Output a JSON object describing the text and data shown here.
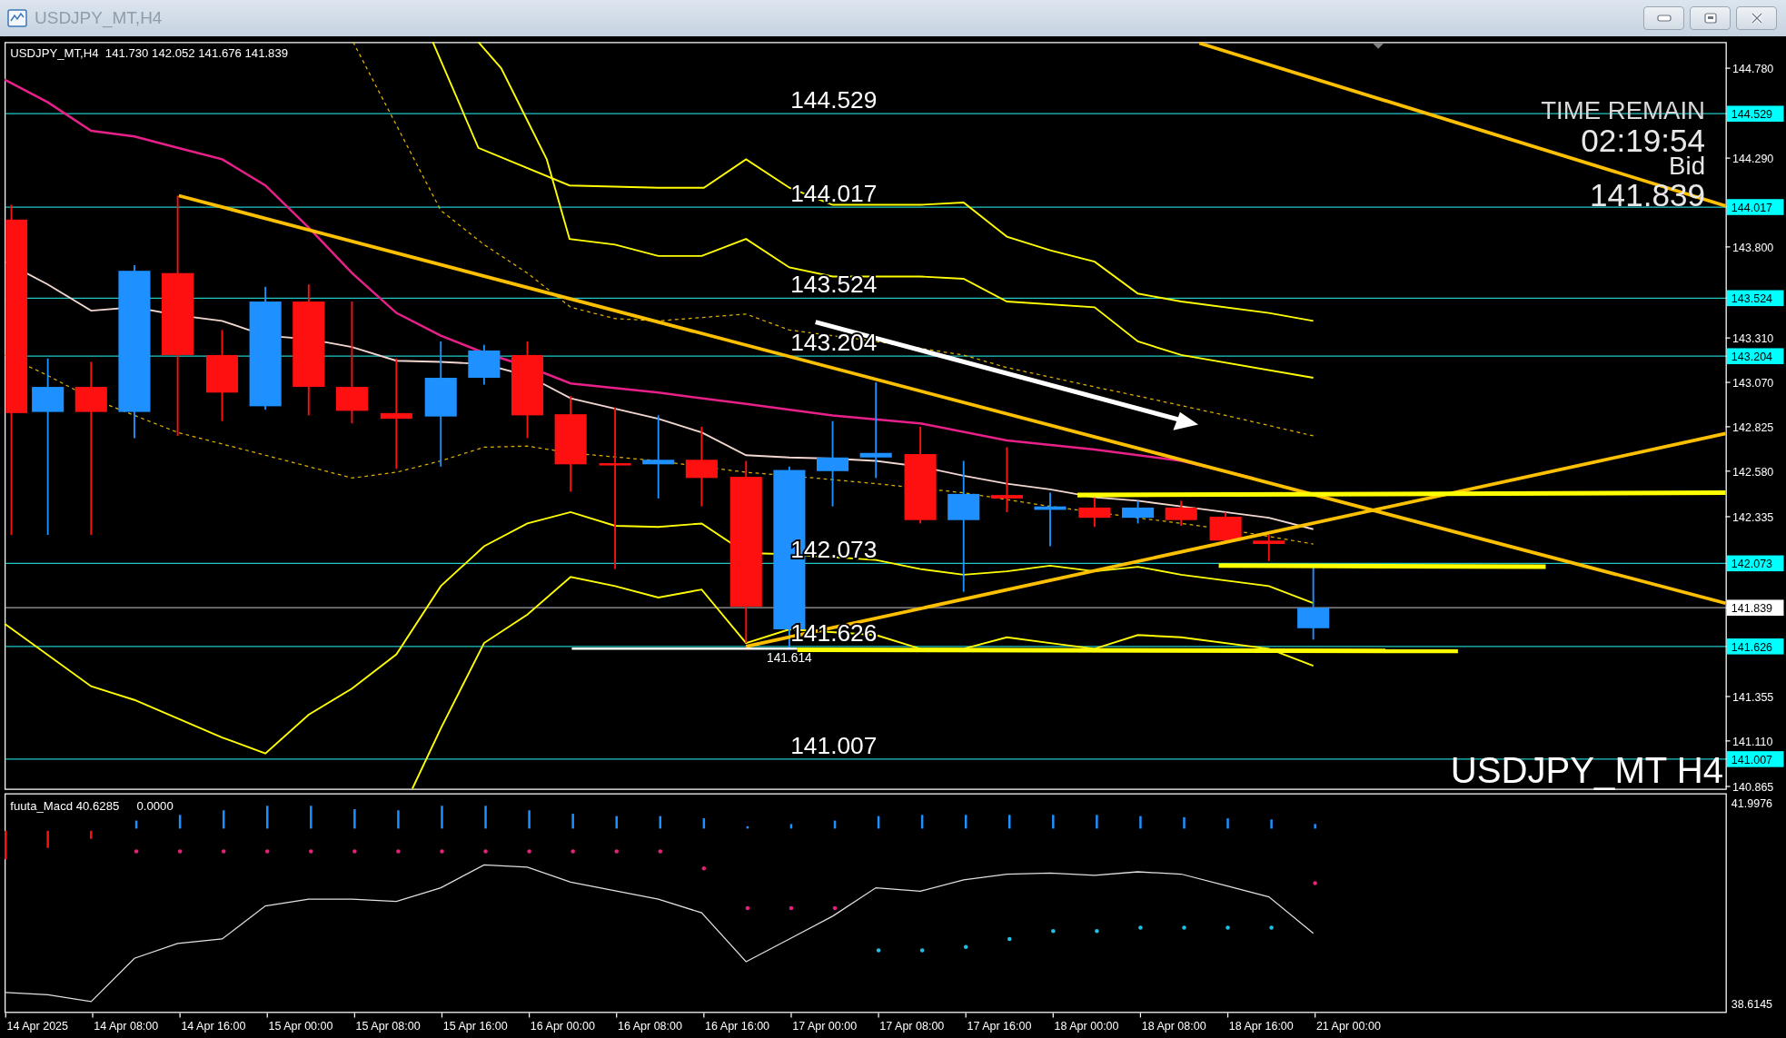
{
  "window": {
    "title": "USDJPY_MT,H4"
  },
  "chart": {
    "header": "USDJPY_MT,H4  141.730 142.052 141.676 141.839",
    "symbol_label": "USDJPY_MT H4",
    "time_remain": {
      "label": "TIME REMAIN",
      "value": "02:19:54",
      "bid_label": "Bid",
      "bid": "141.839"
    },
    "levels": [
      "144.529",
      "144.017",
      "143.524",
      "143.204",
      "142.073",
      "141.626",
      "141.007"
    ],
    "swing_low_label": "141.614",
    "price_axis": [
      {
        "label": "144.780",
        "kind": "tick"
      },
      {
        "label": "144.529",
        "kind": "level"
      },
      {
        "label": "144.290",
        "kind": "tick"
      },
      {
        "label": "144.017",
        "kind": "level"
      },
      {
        "label": "143.800",
        "kind": "tick"
      },
      {
        "label": "143.524",
        "kind": "level"
      },
      {
        "label": "143.310",
        "kind": "tick"
      },
      {
        "label": "143.204",
        "kind": "level"
      },
      {
        "label": "143.070",
        "kind": "tick"
      },
      {
        "label": "142.825",
        "kind": "tick"
      },
      {
        "label": "142.580",
        "kind": "tick"
      },
      {
        "label": "142.335",
        "kind": "tick"
      },
      {
        "label": "142.073",
        "kind": "level"
      },
      {
        "label": "141.839",
        "kind": "bid"
      },
      {
        "label": "141.626",
        "kind": "level"
      },
      {
        "label": "141.355",
        "kind": "tick"
      },
      {
        "label": "141.110",
        "kind": "tick"
      },
      {
        "label": "141.007",
        "kind": "level"
      },
      {
        "label": "140.865",
        "kind": "tick"
      }
    ]
  },
  "macd": {
    "name": "fuuta_Macd",
    "value": "40.6285",
    "signal": "0.0000",
    "scale_max": "41.9976",
    "scale_min": "38.6145"
  },
  "time_axis": [
    "14 Apr 2025",
    "14 Apr 08:00",
    "14 Apr 16:00",
    "15 Apr 00:00",
    "15 Apr 08:00",
    "15 Apr 16:00",
    "16 Apr 00:00",
    "16 Apr 08:00",
    "16 Apr 16:00",
    "17 Apr 00:00",
    "17 Apr 08:00",
    "17 Apr 16:00",
    "18 Apr 00:00",
    "18 Apr 08:00",
    "18 Apr 16:00",
    "21 Apr 00:00"
  ]
}
